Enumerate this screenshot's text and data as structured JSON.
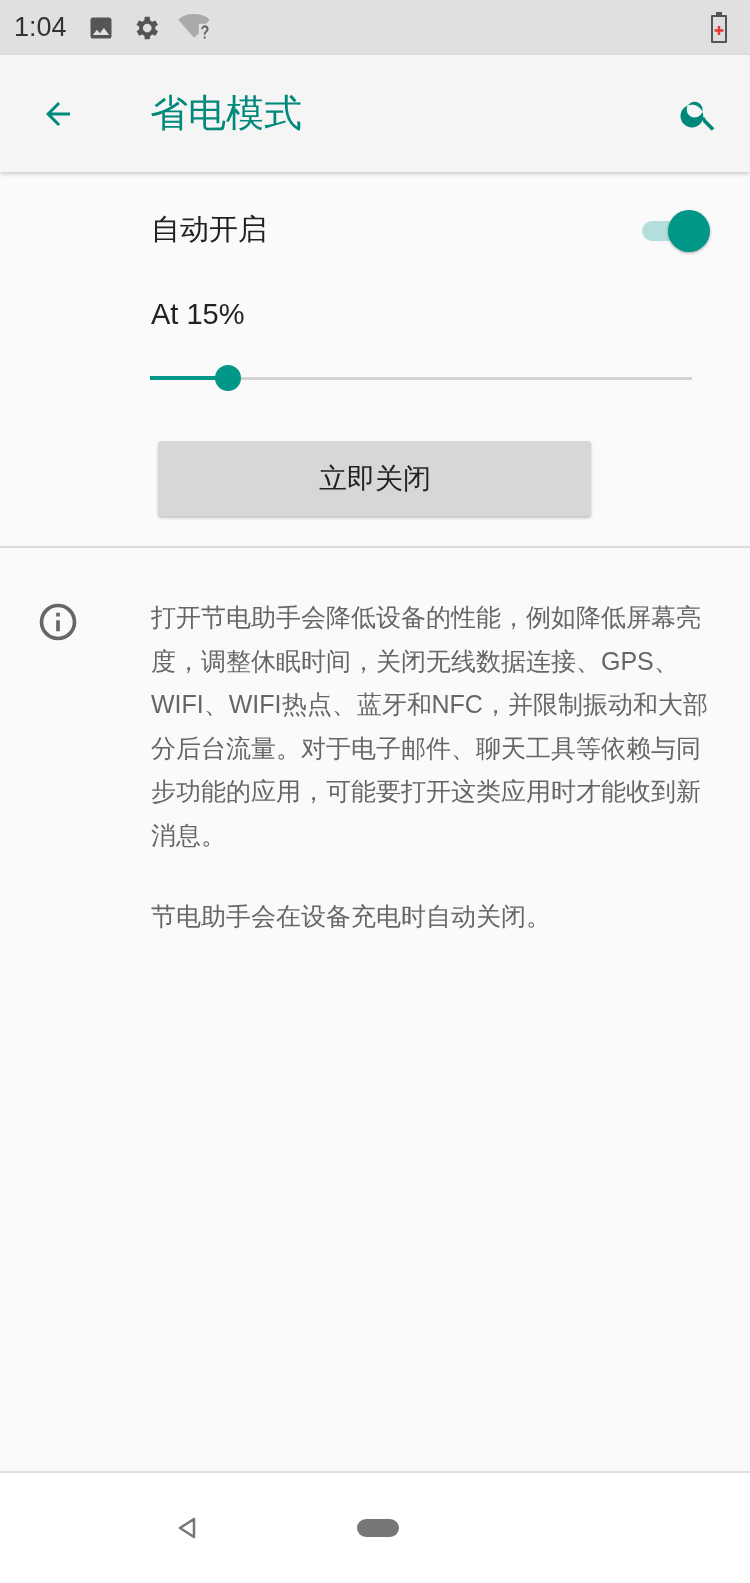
{
  "status_bar": {
    "time": "1:04"
  },
  "app_bar": {
    "title": "省电模式"
  },
  "auto_on": {
    "label": "自动开启",
    "on": true
  },
  "threshold": {
    "label": "At 15%",
    "level": 0.14
  },
  "turn_off_button": "立即关闭",
  "info": {
    "paragraphs": [
      "打开节电助手会降低设备的性能，例如降低屏幕亮度，调整休眠时间，关闭无线数据连接、GPS、WIFI、WIFI热点、蓝牙和NFC，并限制振动和大部分后台流量。对于电子邮件、聊天工具等依赖与同步功能的应用，可能要打开这类应用时才能收到新消息。",
      "节电助手会在设备充电时自动关闭。"
    ]
  }
}
